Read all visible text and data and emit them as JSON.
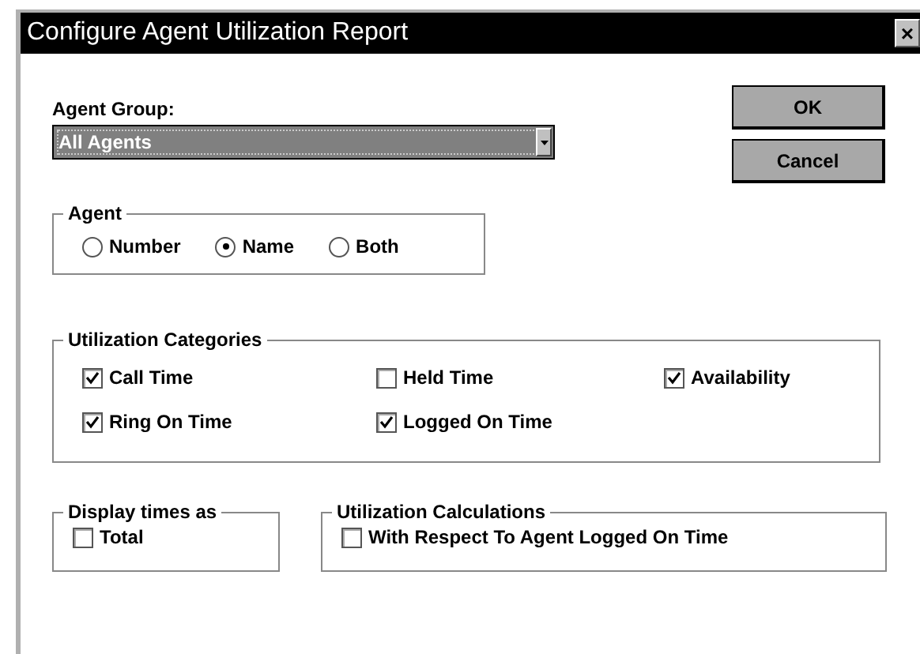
{
  "window": {
    "title": "Configure Agent Utilization Report",
    "close": "×"
  },
  "agent_group": {
    "label": "Agent Group:",
    "value": "All Agents"
  },
  "buttons": [
    "OK",
    "Cancel"
  ],
  "agent": {
    "title": "Agent",
    "options": [
      {
        "label": "Number",
        "selected": false
      },
      {
        "label": "Name",
        "selected": true
      },
      {
        "label": "Both",
        "selected": false
      }
    ]
  },
  "utilization_categories": {
    "title": "Utilization Categories",
    "items": [
      {
        "label": "Call Time",
        "checked": true
      },
      {
        "label": "Held Time",
        "checked": false
      },
      {
        "label": "Availability",
        "checked": true
      },
      {
        "label": "Ring On Time",
        "checked": true
      },
      {
        "label": "Logged On Time",
        "checked": true
      }
    ]
  },
  "display_times_as": {
    "title": "Display times as",
    "items": [
      {
        "label": "Total",
        "checked": false
      }
    ]
  },
  "utilization_calculations": {
    "title": "Utilization Calculations",
    "items": [
      {
        "label": "With Respect To Agent Logged On Time",
        "checked": false
      }
    ]
  }
}
